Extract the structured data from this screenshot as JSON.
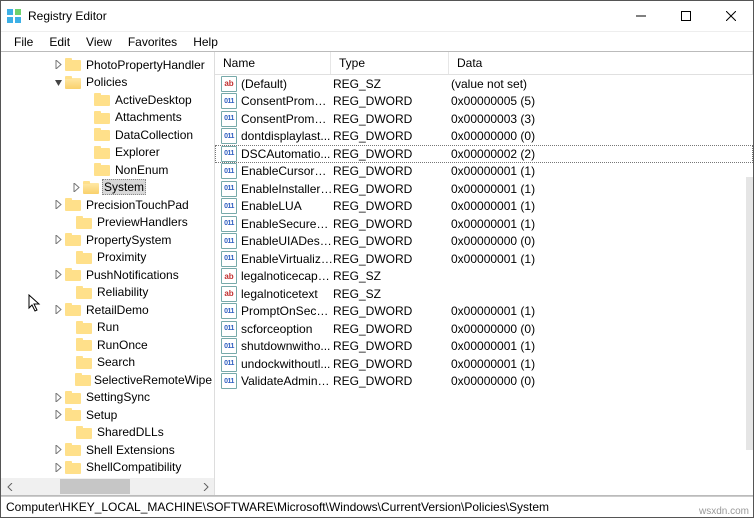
{
  "window": {
    "title": "Registry Editor"
  },
  "menu": {
    "file": "File",
    "edit": "Edit",
    "view": "View",
    "favorites": "Favorites",
    "help": "Help"
  },
  "tree": [
    {
      "label": "PhotoPropertyHandler",
      "indent": 52,
      "twisty": "right",
      "open": false
    },
    {
      "label": "Policies",
      "indent": 52,
      "twisty": "down",
      "open": true
    },
    {
      "label": "ActiveDesktop",
      "indent": 81,
      "twisty": "",
      "open": false
    },
    {
      "label": "Attachments",
      "indent": 81,
      "twisty": "",
      "open": false
    },
    {
      "label": "DataCollection",
      "indent": 81,
      "twisty": "",
      "open": false
    },
    {
      "label": "Explorer",
      "indent": 81,
      "twisty": "",
      "open": false
    },
    {
      "label": "NonEnum",
      "indent": 81,
      "twisty": "",
      "open": false
    },
    {
      "label": "System",
      "indent": 70,
      "twisty": "right",
      "open": true,
      "selected": true
    },
    {
      "label": "PrecisionTouchPad",
      "indent": 52,
      "twisty": "right",
      "open": false
    },
    {
      "label": "PreviewHandlers",
      "indent": 63,
      "twisty": "",
      "open": false
    },
    {
      "label": "PropertySystem",
      "indent": 52,
      "twisty": "right",
      "open": false
    },
    {
      "label": "Proximity",
      "indent": 63,
      "twisty": "",
      "open": false
    },
    {
      "label": "PushNotifications",
      "indent": 52,
      "twisty": "right",
      "open": false
    },
    {
      "label": "Reliability",
      "indent": 63,
      "twisty": "",
      "open": false
    },
    {
      "label": "RetailDemo",
      "indent": 52,
      "twisty": "right",
      "open": false
    },
    {
      "label": "Run",
      "indent": 63,
      "twisty": "",
      "open": false
    },
    {
      "label": "RunOnce",
      "indent": 63,
      "twisty": "",
      "open": false
    },
    {
      "label": "Search",
      "indent": 63,
      "twisty": "",
      "open": false
    },
    {
      "label": "SelectiveRemoteWipe",
      "indent": 63,
      "twisty": "",
      "open": false
    },
    {
      "label": "SettingSync",
      "indent": 52,
      "twisty": "right",
      "open": false
    },
    {
      "label": "Setup",
      "indent": 52,
      "twisty": "right",
      "open": false
    },
    {
      "label": "SharedDLLs",
      "indent": 63,
      "twisty": "",
      "open": false
    },
    {
      "label": "Shell Extensions",
      "indent": 52,
      "twisty": "right",
      "open": false
    },
    {
      "label": "ShellCompatibility",
      "indent": 52,
      "twisty": "right",
      "open": false
    }
  ],
  "columns": {
    "name": "Name",
    "type": "Type",
    "data": "Data"
  },
  "rows": [
    {
      "name": "(Default)",
      "type": "REG_SZ",
      "data": "(value not set)",
      "icon": "str"
    },
    {
      "name": "ConsentPrompt...",
      "type": "REG_DWORD",
      "data": "0x00000005 (5)",
      "icon": "bin"
    },
    {
      "name": "ConsentPrompt...",
      "type": "REG_DWORD",
      "data": "0x00000003 (3)",
      "icon": "bin"
    },
    {
      "name": "dontdisplaylast...",
      "type": "REG_DWORD",
      "data": "0x00000000 (0)",
      "icon": "bin"
    },
    {
      "name": "DSCAutomatio...",
      "type": "REG_DWORD",
      "data": "0x00000002 (2)",
      "icon": "bin",
      "selected": true
    },
    {
      "name": "EnableCursorSu...",
      "type": "REG_DWORD",
      "data": "0x00000001 (1)",
      "icon": "bin"
    },
    {
      "name": "EnableInstallerD...",
      "type": "REG_DWORD",
      "data": "0x00000001 (1)",
      "icon": "bin"
    },
    {
      "name": "EnableLUA",
      "type": "REG_DWORD",
      "data": "0x00000001 (1)",
      "icon": "bin"
    },
    {
      "name": "EnableSecureUI...",
      "type": "REG_DWORD",
      "data": "0x00000001 (1)",
      "icon": "bin"
    },
    {
      "name": "EnableUIADeskt...",
      "type": "REG_DWORD",
      "data": "0x00000000 (0)",
      "icon": "bin"
    },
    {
      "name": "EnableVirtualiza...",
      "type": "REG_DWORD",
      "data": "0x00000001 (1)",
      "icon": "bin"
    },
    {
      "name": "legalnoticecapti...",
      "type": "REG_SZ",
      "data": "",
      "icon": "str"
    },
    {
      "name": "legalnoticetext",
      "type": "REG_SZ",
      "data": "",
      "icon": "str"
    },
    {
      "name": "PromptOnSecur...",
      "type": "REG_DWORD",
      "data": "0x00000001 (1)",
      "icon": "bin"
    },
    {
      "name": "scforceoption",
      "type": "REG_DWORD",
      "data": "0x00000000 (0)",
      "icon": "bin"
    },
    {
      "name": "shutdownwitho...",
      "type": "REG_DWORD",
      "data": "0x00000001 (1)",
      "icon": "bin"
    },
    {
      "name": "undockwithoutl...",
      "type": "REG_DWORD",
      "data": "0x00000001 (1)",
      "icon": "bin"
    },
    {
      "name": "ValidateAdminC...",
      "type": "REG_DWORD",
      "data": "0x00000000 (0)",
      "icon": "bin"
    }
  ],
  "status": {
    "path": "Computer\\HKEY_LOCAL_MACHINE\\SOFTWARE\\Microsoft\\Windows\\CurrentVersion\\Policies\\System"
  },
  "watermark": "wsxdn.com"
}
